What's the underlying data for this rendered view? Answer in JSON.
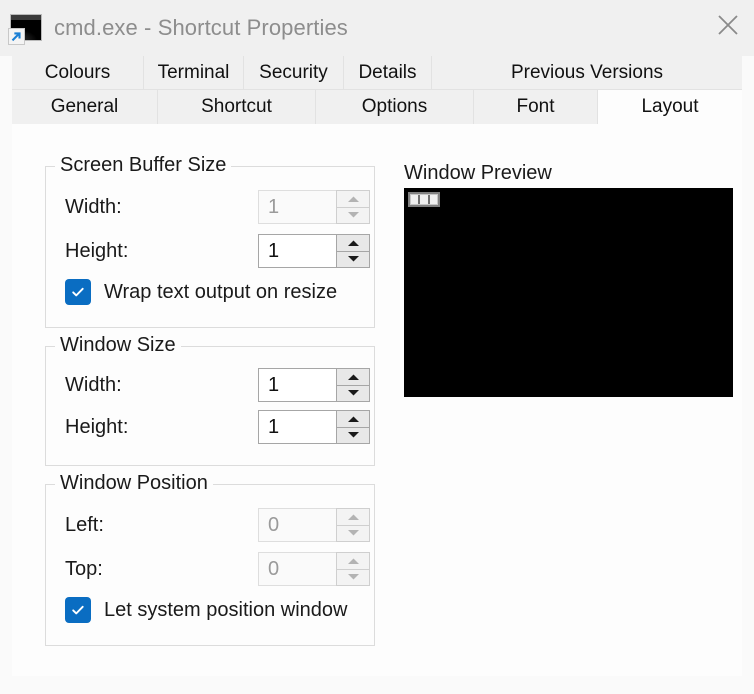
{
  "window": {
    "title": "cmd.exe - Shortcut Properties",
    "icon": "cmd-shortcut-icon",
    "close_label": "✕"
  },
  "tabs": {
    "row1": [
      {
        "label": "Colours",
        "selected": false
      },
      {
        "label": "Terminal",
        "selected": false
      },
      {
        "label": "Security",
        "selected": false
      },
      {
        "label": "Details",
        "selected": false
      },
      {
        "label": "Previous Versions",
        "selected": false
      }
    ],
    "row2": [
      {
        "label": "General",
        "selected": false
      },
      {
        "label": "Shortcut",
        "selected": false
      },
      {
        "label": "Options",
        "selected": false
      },
      {
        "label": "Font",
        "selected": false
      },
      {
        "label": "Layout",
        "selected": true
      }
    ]
  },
  "screen_buffer_size": {
    "legend": "Screen Buffer Size",
    "width": {
      "label": "Width:",
      "value": "1",
      "enabled": false
    },
    "height": {
      "label": "Height:",
      "value": "1",
      "enabled": true
    },
    "wrap_text": {
      "label": "Wrap text output on resize",
      "checked": true
    }
  },
  "window_size": {
    "legend": "Window Size",
    "width": {
      "label": "Width:",
      "value": "1",
      "enabled": true
    },
    "height": {
      "label": "Height:",
      "value": "1",
      "enabled": true
    }
  },
  "window_position": {
    "legend": "Window Position",
    "left": {
      "label": "Left:",
      "value": "0",
      "enabled": false
    },
    "top": {
      "label": "Top:",
      "value": "0",
      "enabled": false
    },
    "let_system_position": {
      "label": "Let system position window",
      "checked": true
    }
  },
  "window_preview": {
    "title": "Window Preview",
    "background_color": "#000000"
  },
  "colors": {
    "accent": "#0a6dc2",
    "titlebar_bg": "#f0f0f0",
    "panel_bg": "#fdfdfd",
    "page_bg": "#fafafa",
    "tab_bg": "#f0f0f0",
    "title_text": "#8d8d8d",
    "disabled_text": "#9a9a9a"
  }
}
